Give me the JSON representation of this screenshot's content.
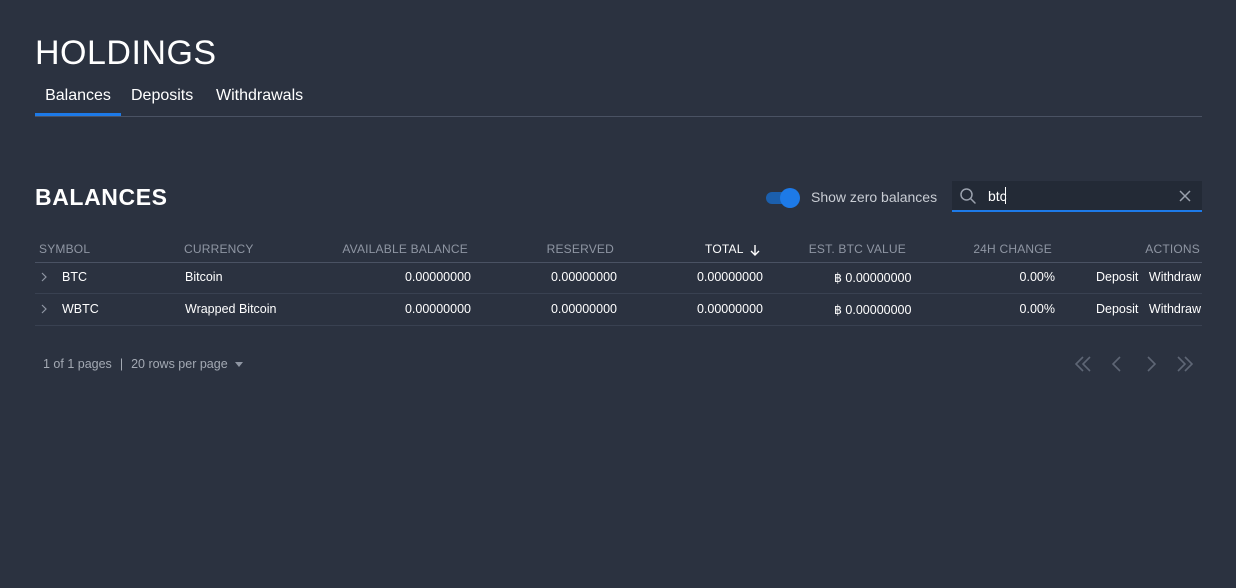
{
  "page": {
    "title": "HOLDINGS",
    "tabs": [
      {
        "label": "Balances",
        "active": true
      },
      {
        "label": "Deposits",
        "active": false
      },
      {
        "label": "Withdrawals",
        "active": false
      }
    ]
  },
  "balances": {
    "title": "BALANCES",
    "show_zero_label": "Show zero balances",
    "show_zero_on": true,
    "search": {
      "value": "btc",
      "placeholder": ""
    },
    "columns": {
      "symbol": "SYMBOL",
      "currency": "CURRENCY",
      "available": "AVAILABLE BALANCE",
      "reserved": "RESERVED",
      "total": "TOTAL",
      "btc_value": "EST. BTC VALUE",
      "change": "24H CHANGE",
      "actions": "ACTIONS"
    },
    "rows": [
      {
        "symbol": "BTC",
        "currency": "Bitcoin",
        "available": "0.00000000",
        "reserved": "0.00000000",
        "total": "0.00000000",
        "btc_value": "฿ 0.00000000",
        "change": "0.00%",
        "deposit": "Deposit",
        "withdraw": "Withdraw"
      },
      {
        "symbol": "WBTC",
        "currency": "Wrapped Bitcoin",
        "available": "0.00000000",
        "reserved": "0.00000000",
        "total": "0.00000000",
        "btc_value": "฿ 0.00000000",
        "change": "0.00%",
        "deposit": "Deposit",
        "withdraw": "Withdraw"
      }
    ],
    "pagination": {
      "pages_text": "1 of 1 pages",
      "separator": "|",
      "rows_per_page": "20 rows per page"
    }
  },
  "colors": {
    "background": "#2b3240",
    "accent": "#1d7ae8",
    "link": "#1d87e8"
  }
}
